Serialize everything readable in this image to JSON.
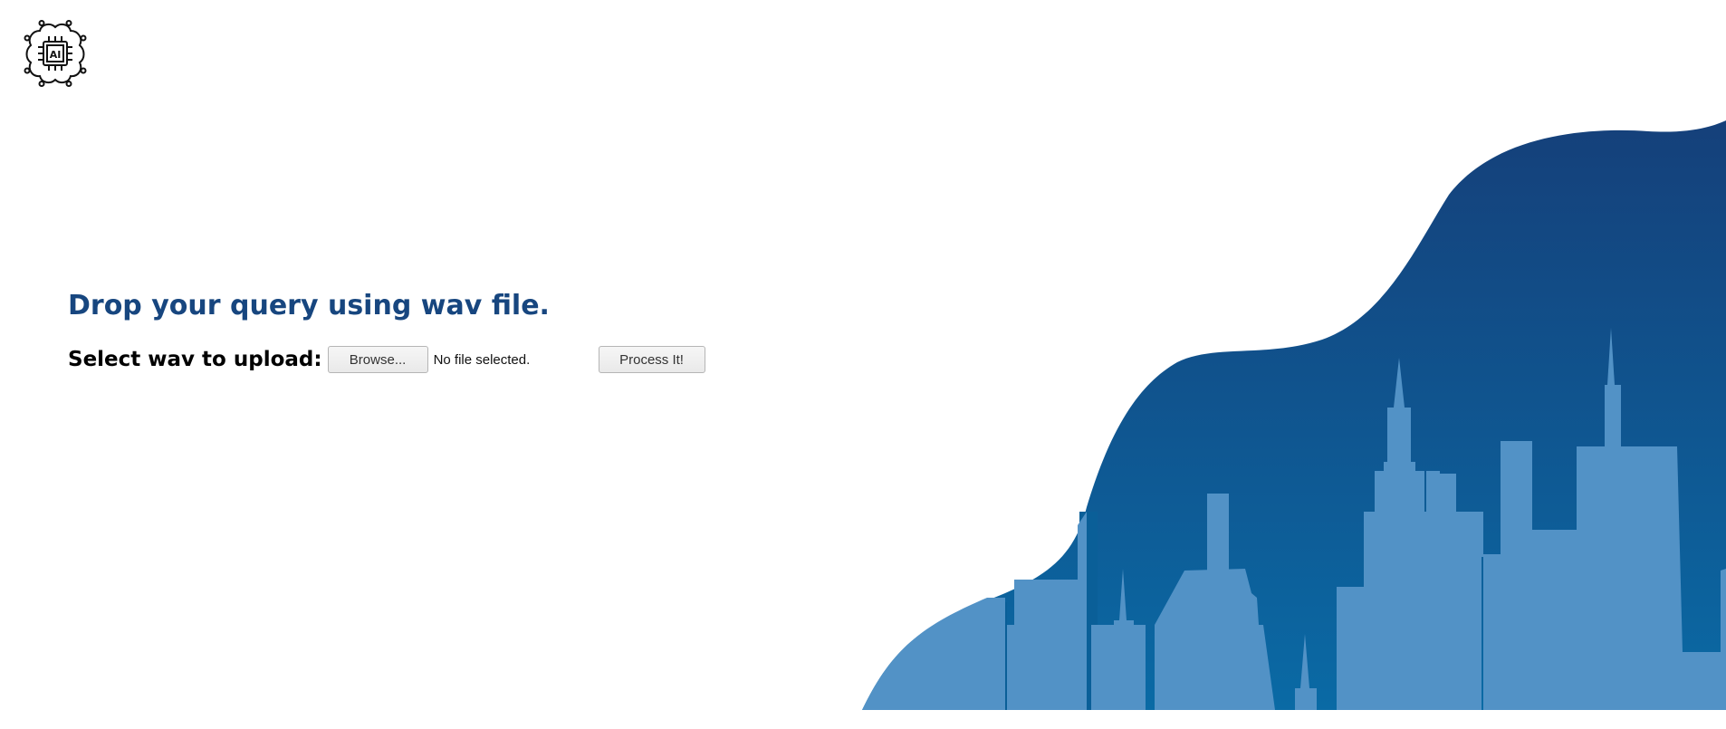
{
  "logo": {
    "icon": "ai-chip-brain-icon",
    "text": "AI"
  },
  "hero": {
    "heading": "Drop your query using wav file.",
    "upload_label": "Select wav to upload:",
    "browse_label": "Browse...",
    "file_status": "No file selected.",
    "process_label": "Process It!"
  },
  "colors": {
    "heading": "#17467f",
    "wave_top": "#15427a",
    "wave_bottom": "#0b6aa3",
    "skyline": "#5291c6"
  }
}
